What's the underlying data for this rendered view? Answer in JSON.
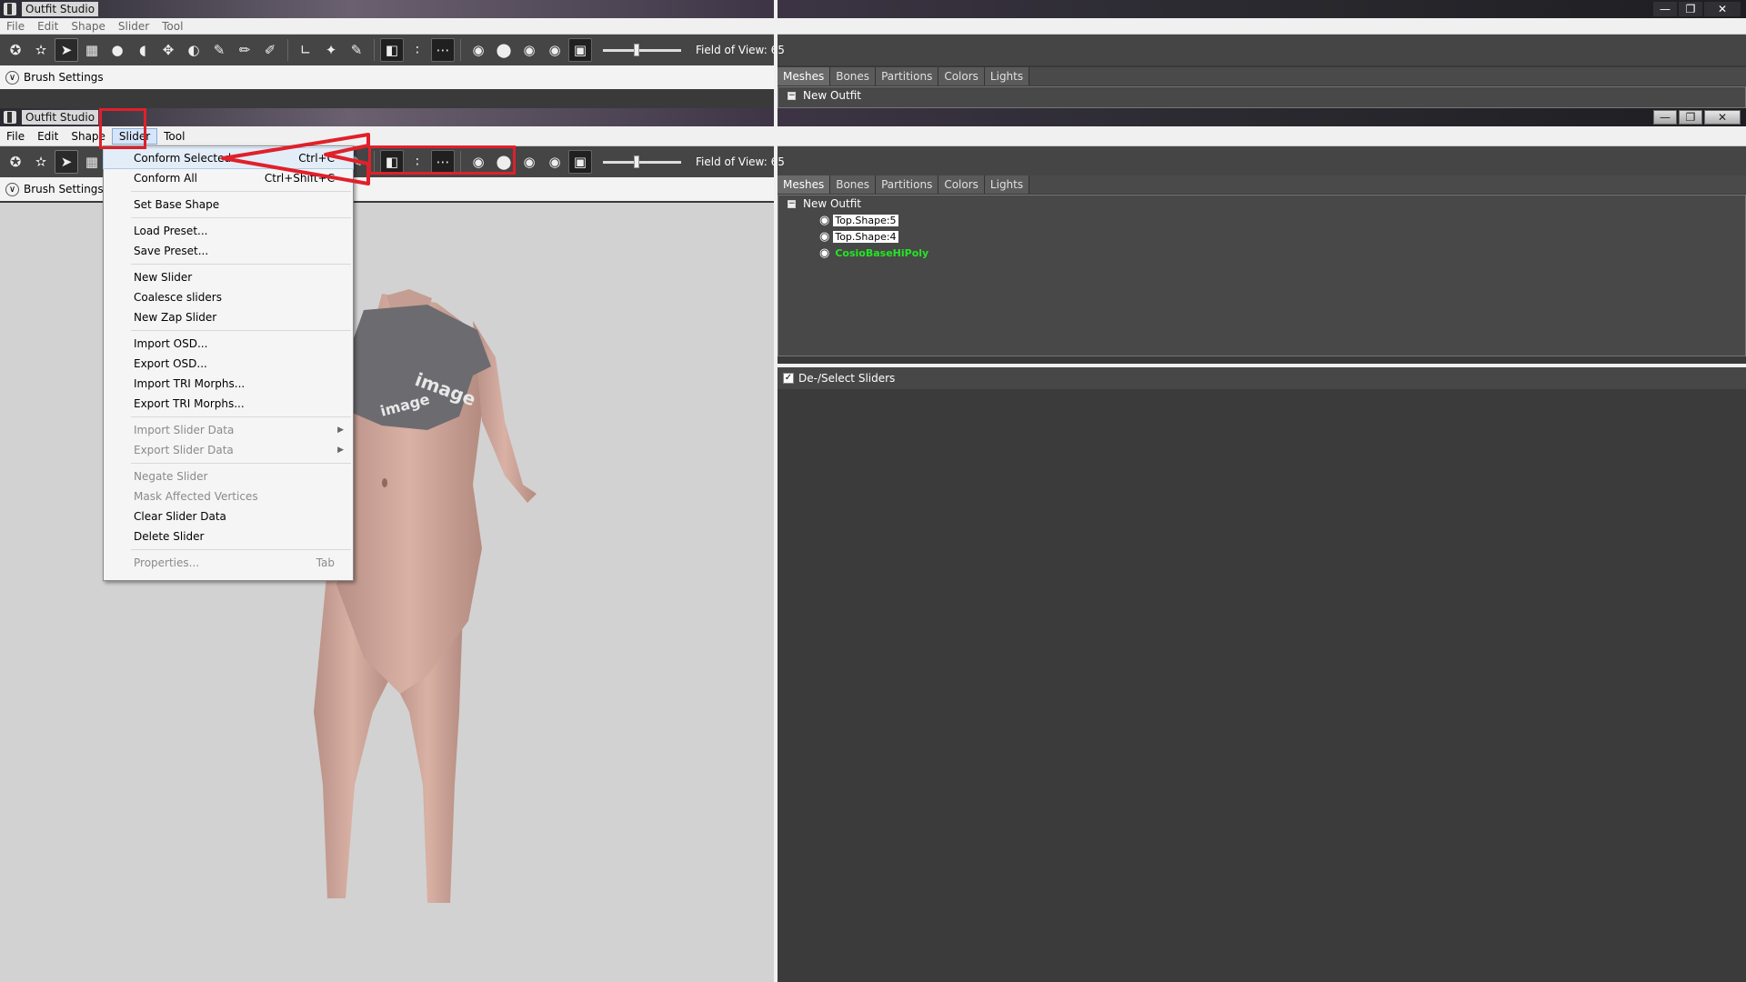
{
  "app_title": "Outfit Studio",
  "menubar": [
    "File",
    "Edit",
    "Shape",
    "Slider",
    "Tool"
  ],
  "toolbar": {
    "fov_label": "Field of View: 65"
  },
  "brush_settings_label": "Brush Settings",
  "tabs": [
    "Meshes",
    "Bones",
    "Partitions",
    "Colors",
    "Lights"
  ],
  "tree": {
    "root": "New Outfit",
    "shapes": [
      "Top.Shape:5",
      "Top.Shape:4",
      "CosioBaseHiPoly"
    ]
  },
  "sliders_header": "De-/Select Sliders",
  "slider_menu": {
    "conform_selected": "Conform Selected",
    "conform_selected_sc": "Ctrl+C",
    "conform_all": "Conform All",
    "conform_all_sc": "Ctrl+Shift+C",
    "set_base_shape": "Set Base Shape",
    "load_preset": "Load Preset...",
    "save_preset": "Save Preset...",
    "new_slider": "New Slider",
    "coalesce_sliders": "Coalesce sliders",
    "new_zap_slider": "New Zap Slider",
    "import_osd": "Import OSD...",
    "export_osd": "Export OSD...",
    "import_tri": "Import TRI Morphs...",
    "export_tri": "Export TRI Morphs...",
    "import_slider_data": "Import Slider Data",
    "export_slider_data": "Export Slider Data",
    "negate_slider": "Negate Slider",
    "mask_affected": "Mask Affected Vertices",
    "clear_slider_data": "Clear Slider Data",
    "delete_slider": "Delete Slider",
    "properties": "Properties...",
    "properties_sc": "Tab"
  },
  "colors": {
    "annotation_red": "#e0202a",
    "reference_shape_green": "#22e622"
  }
}
